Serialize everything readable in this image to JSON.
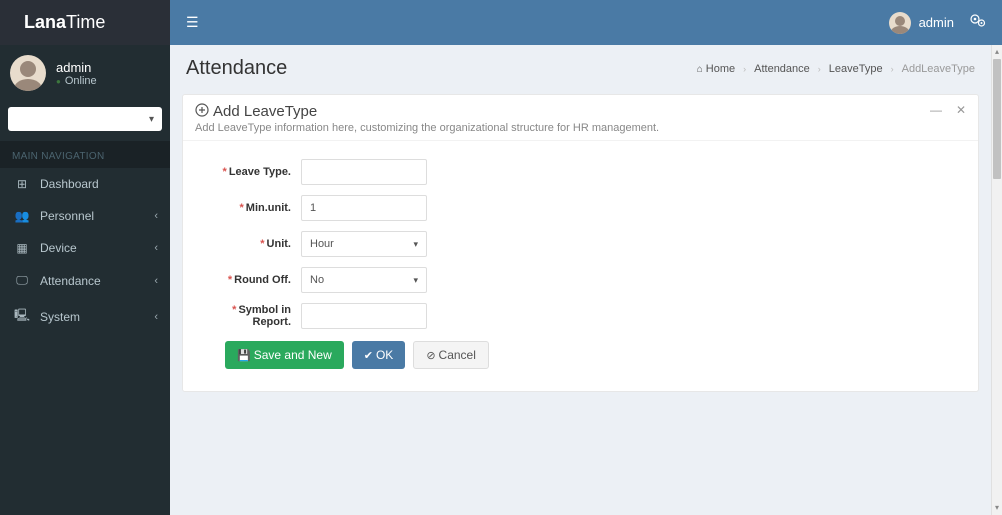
{
  "brand": {
    "strong": "Lana",
    "light": "Time"
  },
  "topbar": {
    "username": "admin"
  },
  "user_panel": {
    "name": "admin",
    "status": "Online"
  },
  "nav": {
    "header": "MAIN NAVIGATION",
    "items": [
      {
        "icon": "⊞",
        "label": "Dashboard",
        "caret": false
      },
      {
        "icon": "👥",
        "label": "Personnel",
        "caret": true
      },
      {
        "icon": "▦",
        "label": "Device",
        "caret": true
      },
      {
        "icon": "🖵",
        "label": "Attendance",
        "caret": true
      },
      {
        "icon": "🖳",
        "label": "System",
        "caret": true
      }
    ]
  },
  "header": {
    "title": "Attendance"
  },
  "breadcrumb": {
    "home": "Home",
    "b1": "Attendance",
    "b2": "LeaveType",
    "b3": "AddLeaveType"
  },
  "panel": {
    "title": "Add LeaveType",
    "subtitle": "Add LeaveType information here, customizing the organizational structure for HR management."
  },
  "form": {
    "leave_type": {
      "label": "Leave Type.",
      "value": ""
    },
    "min_unit": {
      "label": "Min.unit.",
      "value": "1"
    },
    "unit": {
      "label": "Unit.",
      "value": "Hour"
    },
    "round_off": {
      "label": "Round Off.",
      "value": "No"
    },
    "symbol": {
      "label": "Symbol in Report.",
      "value": ""
    }
  },
  "buttons": {
    "save_new": "Save and New",
    "ok": "OK",
    "cancel": "Cancel"
  }
}
